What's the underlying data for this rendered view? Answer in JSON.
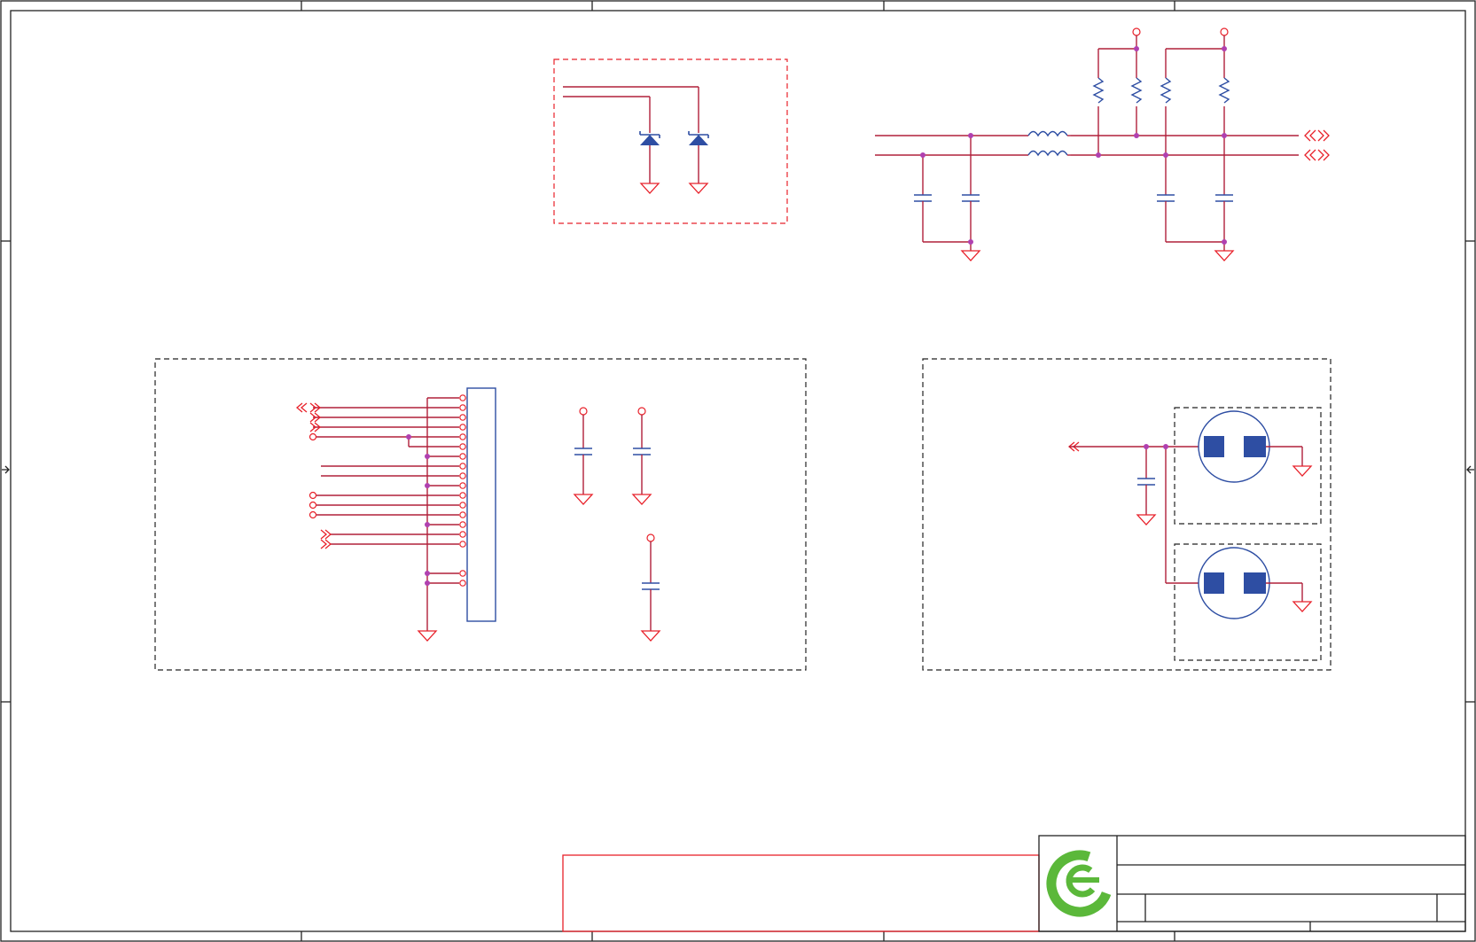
{
  "sheet": {
    "background": "#ffffff",
    "colors": {
      "net_wire": "#b0203a",
      "power_symbol": "#e8212a",
      "component_body": "#2e4ea3",
      "junction": "#b040b0",
      "frame": "#222222",
      "logo_green": "#5bb83a"
    }
  },
  "blocks": [
    {
      "id": "esd-protection",
      "border": "red-dashed",
      "components": [
        "tvs-diode",
        "tvs-diode"
      ]
    },
    {
      "id": "common-mode-filter",
      "border": "none",
      "components": [
        "inductor",
        "inductor",
        "resistor",
        "resistor",
        "resistor",
        "resistor",
        "capacitor",
        "capacitor",
        "capacitor",
        "capacitor"
      ]
    },
    {
      "id": "connector-block",
      "border": "black-dashed",
      "components": [
        "connector",
        "capacitor",
        "capacitor",
        "capacitor"
      ]
    },
    {
      "id": "mounting-holes",
      "border": "black-dashed",
      "components": [
        "mounting-hole",
        "mounting-hole",
        "capacitor"
      ]
    }
  ],
  "title_block": {
    "logo_icon": "green-e-logo-icon"
  }
}
